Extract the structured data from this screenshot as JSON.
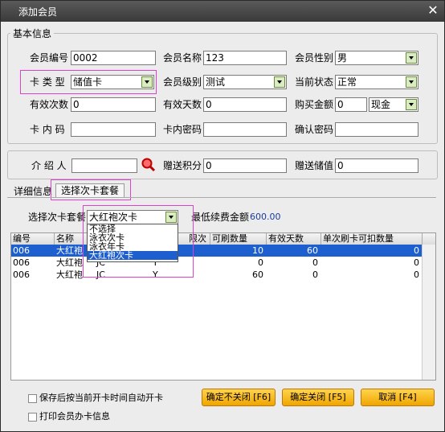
{
  "window": {
    "title": "添加会员",
    "close": "✕"
  },
  "basic": {
    "legend": "基本信息",
    "member_no_label": "会员编号",
    "member_no": "0002",
    "member_name_label": "会员名称",
    "member_name": "123",
    "gender_label": "会员性别",
    "gender": "男",
    "card_type_label": "卡 类 型",
    "card_type": "储值卡",
    "level_label": "会员级别",
    "level": "测试",
    "status_label": "当前状态",
    "status": "正常",
    "valid_count_label": "有效次数",
    "valid_count": "0",
    "valid_days_label": "有效天数",
    "valid_days": "0",
    "buy_amount_label": "购买金额",
    "buy_amount": "0",
    "pay_method": "现金",
    "card_no_label": "卡 内 码",
    "card_no": "",
    "card_pwd_label": "卡内密码",
    "card_pwd": "",
    "confirm_pwd_label": "确认密码",
    "confirm_pwd": ""
  },
  "intro": {
    "referrer_label": "介 绍 人",
    "referrer": "",
    "bonus_points_label": "赠送积分",
    "bonus_points": "0",
    "bonus_value_label": "赠送储值",
    "bonus_value": "0"
  },
  "tabs": [
    {
      "label": "详细信息"
    },
    {
      "label": "选择次卡套餐"
    }
  ],
  "package": {
    "select_label": "选择次卡套餐",
    "selected": "大红袍次卡",
    "min_spend_label": "最低续费金额",
    "min_spend": "600.00",
    "options": [
      "不选择",
      "泳衣次卡",
      "泳衣年卡",
      "大红袍次卡"
    ]
  },
  "grid": {
    "columns": [
      "编号",
      "名称",
      "",
      "可刷数量",
      "有效天数",
      "单次刷卡可扣数量"
    ],
    "hidden_header_tail": "限次",
    "rows": [
      {
        "id": "006",
        "name": "大红袍",
        "c3": "",
        "c4": "",
        "qty": "10",
        "days": "60",
        "per": "0"
      },
      {
        "id": "006",
        "name": "大红袍",
        "c3": "JC",
        "c4": "Y",
        "qty": "0",
        "days": "0",
        "per": "0"
      },
      {
        "id": "006",
        "name": "大红袍",
        "c3": "JC",
        "c4": "Y",
        "qty": "60",
        "days": "0",
        "per": "0"
      }
    ]
  },
  "options": {
    "auto_open": "保存后按当前开卡时间自动开卡",
    "print_info": "打印会员办卡信息"
  },
  "buttons": {
    "ok_stay": "确定不关闭 [F6]",
    "ok_close": "确定关闭 [F5]",
    "cancel": "取消 [F4]"
  },
  "colors": {
    "accent": "#f0a500",
    "highlight": "#1e5fd0",
    "pink": "#e040d0",
    "title_bar": "#3a3a3a"
  }
}
